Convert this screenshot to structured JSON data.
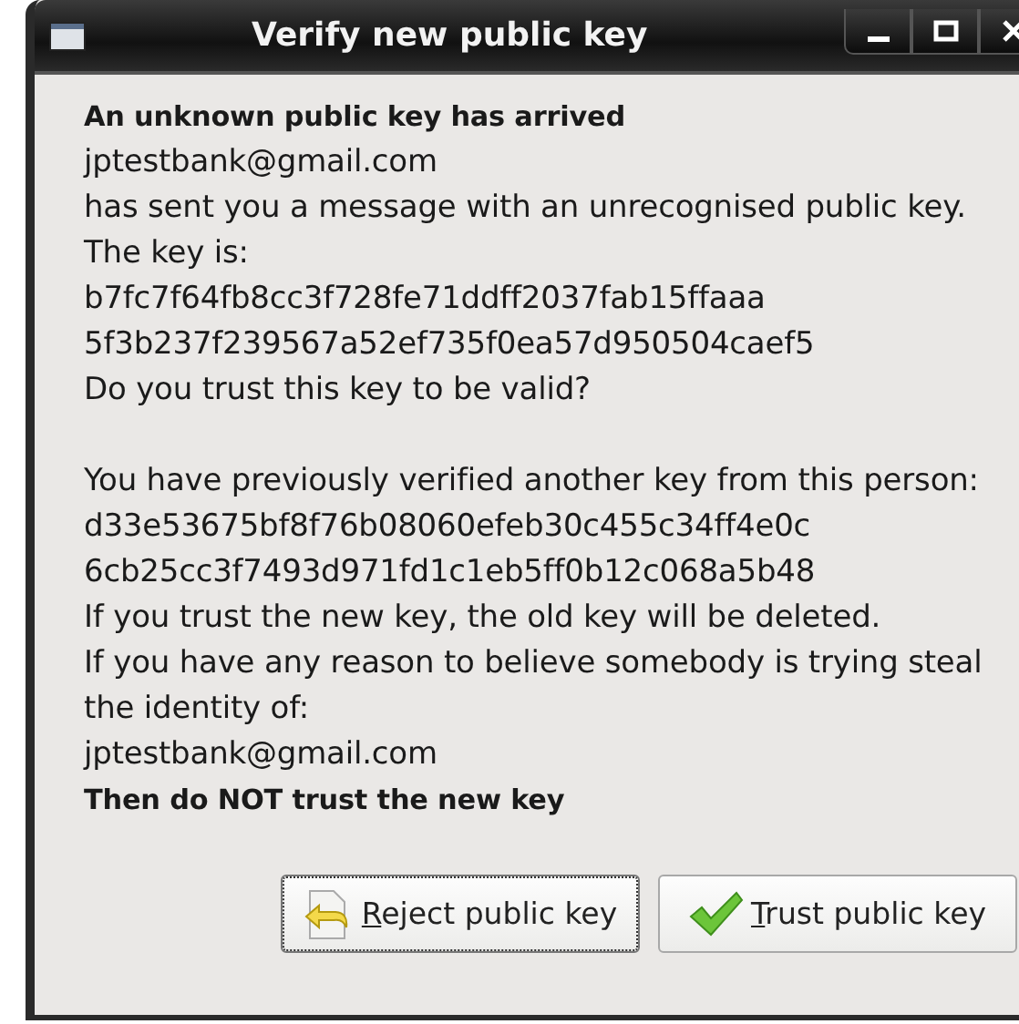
{
  "window": {
    "title": "Verify new public key",
    "controls": [
      {
        "kind": "minimize"
      },
      {
        "kind": "maximize"
      },
      {
        "kind": "close"
      }
    ]
  },
  "paragraphs": [
    {
      "lines": [
        {
          "text": "An unknown public key has arrived",
          "bold": true
        },
        {
          "text": "jptestbank@gmail.com",
          "bold": false
        },
        {
          "text": "has sent you a message with an unrecognised public key.",
          "bold": false
        },
        {
          "text": "The key is:",
          "bold": false
        },
        {
          "text": "b7fc7f64fb8cc3f728fe71ddff2037fab15ffaaa",
          "bold": false
        },
        {
          "text": "5f3b237f239567a52ef735f0ea57d950504caef5",
          "bold": false
        },
        {
          "text": "Do you trust this key to be valid?",
          "bold": false
        }
      ]
    },
    {
      "lines": [
        {
          "text": "You have previously verified another key from this person:",
          "bold": false
        },
        {
          "text": "d33e53675bf8f76b08060efeb30c455c34ff4e0c",
          "bold": false
        },
        {
          "text": "6cb25cc3f7493d971fd1c1eb5ff0b12c068a5b48",
          "bold": false
        },
        {
          "text": "If you trust the new key, the old key will be deleted.",
          "bold": false
        },
        {
          "text": "If you have any reason to believe somebody is trying steal",
          "bold": false
        },
        {
          "text": "the identity of:",
          "bold": false
        },
        {
          "text": "jptestbank@gmail.com",
          "bold": false
        },
        {
          "text": "Then do NOT trust the new key",
          "bold": true
        }
      ]
    }
  ],
  "buttons": [
    {
      "label": "Reject public key",
      "kind": "reject",
      "focused": true
    },
    {
      "label": "Trust public key",
      "kind": "trust",
      "focused": false
    }
  ]
}
